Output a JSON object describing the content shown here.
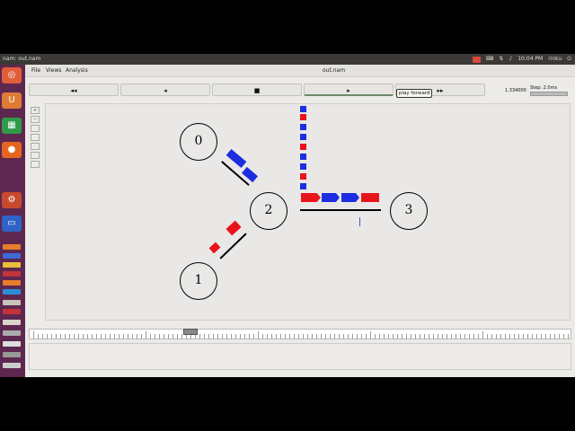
{
  "window": {
    "title": "nam: out.nam",
    "inner_title": "out.nam"
  },
  "menu": {
    "file": "File",
    "views": "Views",
    "analysis": "Analysis"
  },
  "tray": {
    "time": "10:04 PM",
    "user": "rinku"
  },
  "controls": {
    "rewind": "◂◂",
    "back": "◂",
    "stop": "■",
    "play": "▸",
    "fast_forward": "▸▸",
    "tooltip": "play forward",
    "time": "1.334000",
    "step": "Step: 2.0ms"
  },
  "nodes": {
    "n0": "0",
    "n1": "1",
    "n2": "2",
    "n3": "3"
  },
  "colors": {
    "red_packet": "#e8141c",
    "blue_packet": "#1c2ee0",
    "launcher": "#5e2750",
    "topbar": "#3a3935"
  },
  "icons": [
    "ubuntu-icon",
    "ubuntu-one-icon",
    "spreadsheet-icon",
    "firefox-icon",
    "settings-icon",
    "app-icon"
  ]
}
